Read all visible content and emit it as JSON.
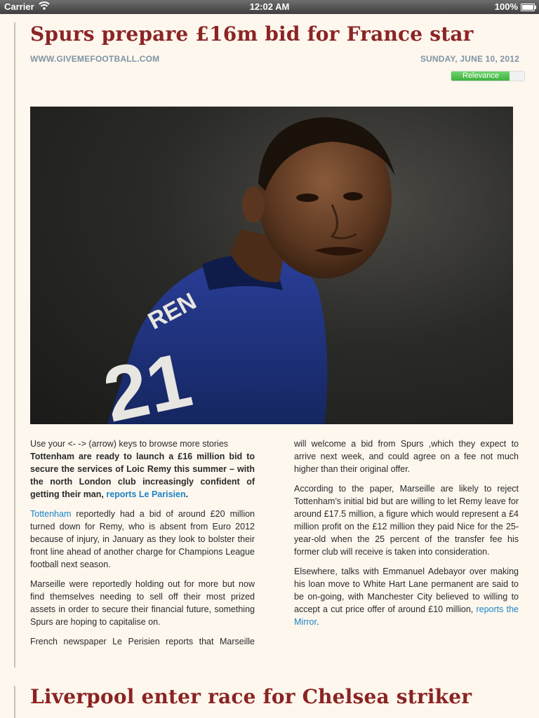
{
  "status_bar": {
    "carrier": "Carrier",
    "time": "12:02 AM",
    "battery": "100%"
  },
  "article": {
    "title": "Spurs prepare £16m bid for France star",
    "source": "WWW.GIVEMEFOOTBALL.COM",
    "date": "SUNDAY, JUNE 10, 2012",
    "relevance": {
      "label": "Relevance",
      "level": 0.8
    },
    "photo_alt": "footballer",
    "body": {
      "hint": "Use your <- -> (arrow) keys to browse more stories",
      "lead": "Tottenham are ready to launch a £16 million bid to secure the services of Loic Remy this summer – with the north London club increasingly confident of getting their man, ",
      "lead_link": "reports Le Parisien",
      "lead_end": ".",
      "p2_link": "Tottenham",
      "p2_text": " reportedly had a bid of around £20 million turned down for Remy, who is absent from Euro 2012 because of injury, in January as they look to bolster their front line ahead of another charge for Champions League football next season.",
      "p3": "Marseille were reportedly holding out for more but now find themselves needing to sell off their most prized assets in order to secure their financial future, something Spurs are hoping to capitalise on.",
      "p4_start": "French newspaper Le Perisien reports that Marseille",
      "p4_end": "will welcome a bid from Spurs ,which they expect to arrive next week, and could agree on a fee not much higher than their original offer.",
      "p5": "According to the paper, Marseille are likely to reject Tottenham’s initial bid but are willing to let Remy leave for around £17.5 million, a figure which would represent a £4 million profit on the £12 million they paid Nice for the 25-year-old when the 25 percent of the transfer fee his former club will receive is taken into consideration.",
      "p6_text": "Elsewhere, talks with Emmanuel Adebayor over making his loan move to White Hart Lane permanent are said to be on-going, with Manchester City believed to willing to accept a cut price offer of around £10 million, ",
      "p6_link": "reports the Mirror",
      "p6_end": "."
    }
  },
  "next_article": {
    "title": "Liverpool enter race for Chelsea striker"
  },
  "colors": {
    "headline": "#8b2423",
    "meta": "#8193a3",
    "link": "#1d83c6",
    "relevance": "#4cbf4c"
  }
}
